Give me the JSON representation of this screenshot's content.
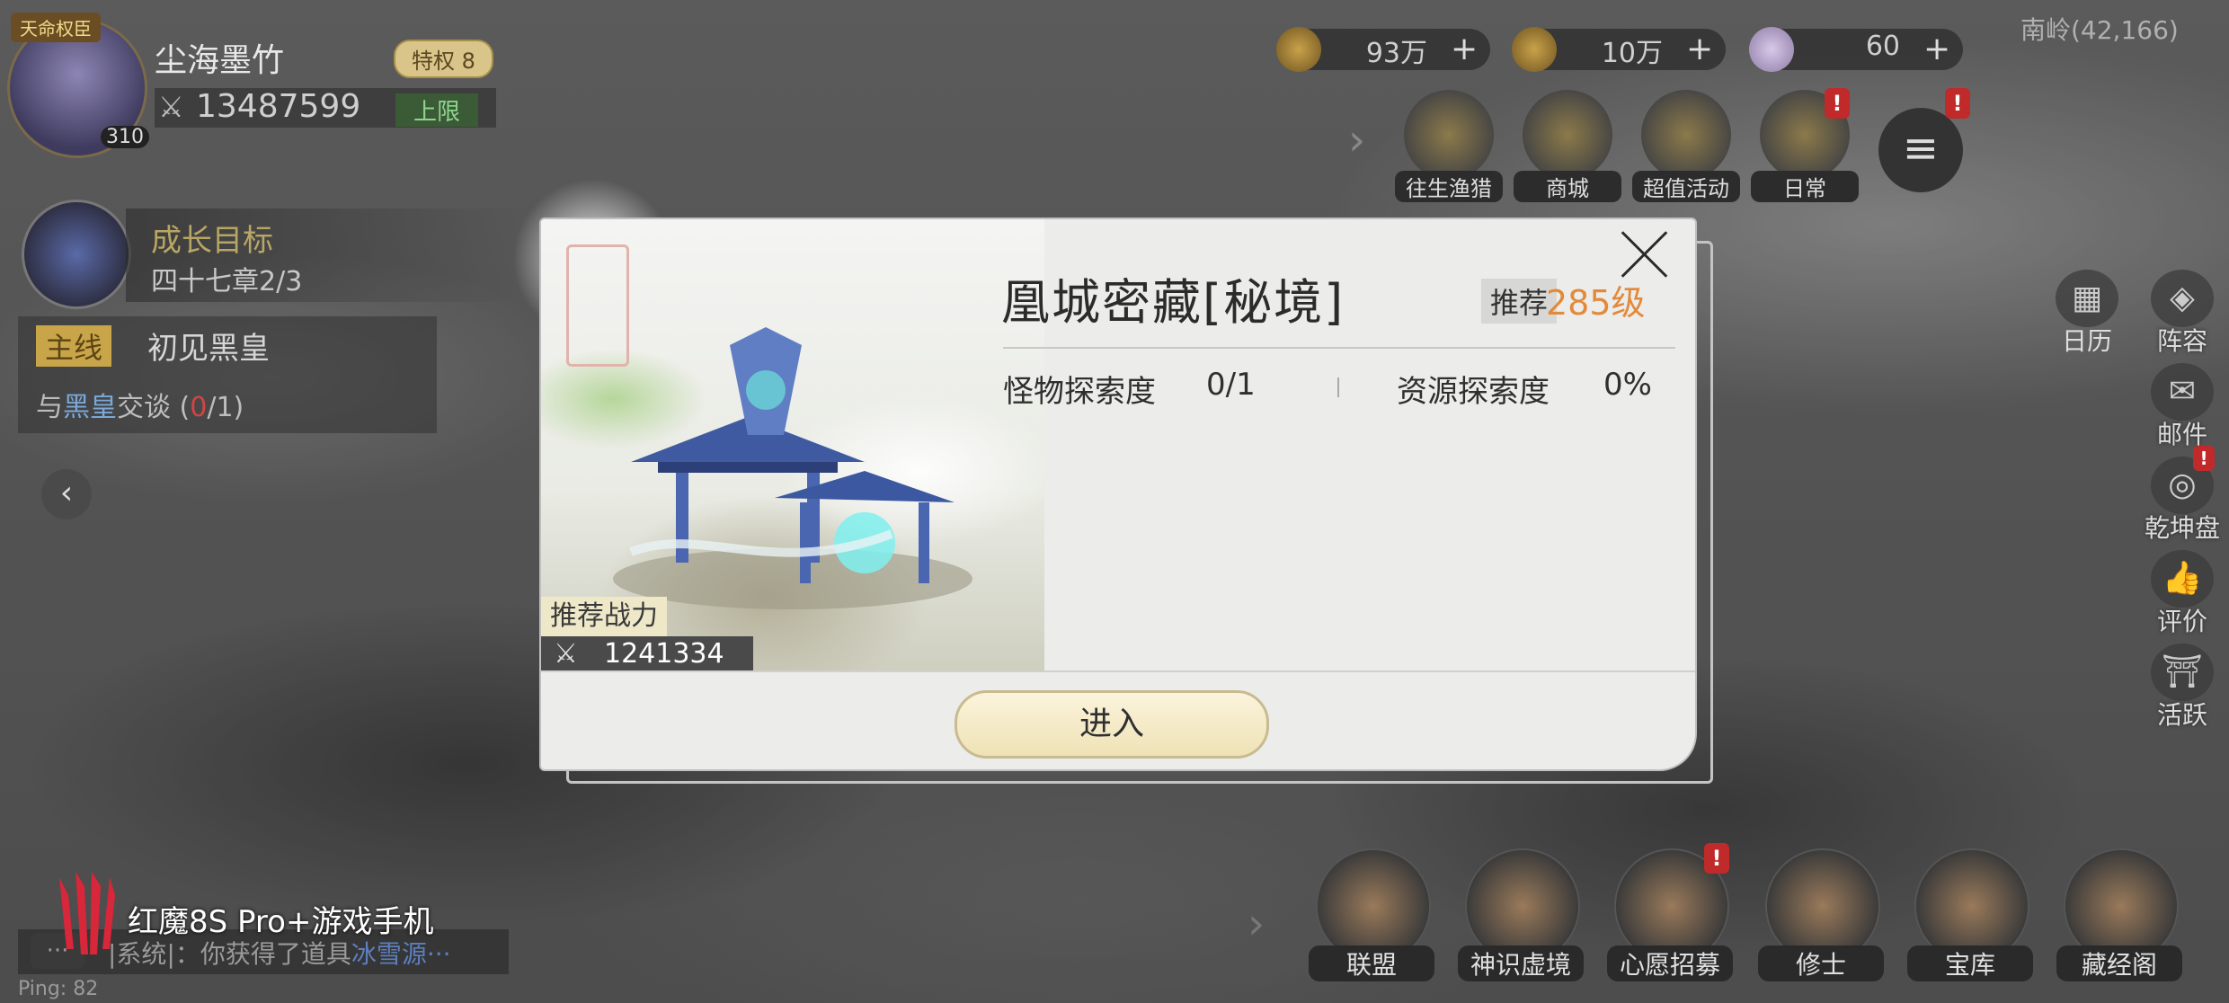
{
  "player": {
    "title_badge": "天命权臣",
    "name": "尘海墨竹",
    "vip": "特权 8",
    "power": "13487599",
    "limit": "上限",
    "level": "310"
  },
  "goal": {
    "title": "成长目标",
    "subtitle": "四十七章2/3"
  },
  "quest": {
    "tag": "主线",
    "name": "初见黑皇",
    "task_prefix": "与",
    "task_npc": "黑皇",
    "task_suffix": "交谈",
    "task_count_open": "(",
    "task_count_done": "0",
    "task_count_rest": "/1)"
  },
  "resources": [
    {
      "icon": "copper-coin-icon",
      "value": "93万"
    },
    {
      "icon": "gourd-icon",
      "value": "10万"
    },
    {
      "icon": "crystal-icon",
      "value": "60"
    }
  ],
  "location": "南岭(42,166)",
  "top_buttons": [
    {
      "label": "往生渔猎",
      "alert": false
    },
    {
      "label": "商城",
      "alert": false
    },
    {
      "label": "超值活动",
      "alert": false
    },
    {
      "label": "日常",
      "alert": true
    }
  ],
  "alert_mark": "!",
  "side_buttons": [
    {
      "label": "阵容",
      "icon": "formation-icon"
    },
    {
      "label": "邮件",
      "icon": "mail-icon"
    },
    {
      "label": "乾坤盘",
      "icon": "compass-icon"
    },
    {
      "label": "评价",
      "icon": "thumbs-up-icon"
    },
    {
      "label": "活跃",
      "icon": "pagoda-icon"
    }
  ],
  "calendar_label": "日历",
  "bottom_buttons": [
    {
      "label": "联盟",
      "alert": false
    },
    {
      "label": "神识虚境",
      "alert": false
    },
    {
      "label": "心愿招募",
      "alert": true
    },
    {
      "label": "修士",
      "alert": false
    },
    {
      "label": "宝库",
      "alert": false
    },
    {
      "label": "藏经阁",
      "alert": false
    }
  ],
  "chat": {
    "prefix": "|系统|：你获得了道具",
    "item": "冰雪源···"
  },
  "ping": "Ping: 82",
  "watermark": "红魔8S Pro+游戏手机",
  "dialog": {
    "title": "凰城密藏[秘境]",
    "recommend_tag": "推荐",
    "recommend_level": "285级",
    "monster_label": "怪物探索度",
    "monster_value": "0/1",
    "resource_label": "资源探索度",
    "resource_value": "0%",
    "rec_power_label": "推荐战力",
    "rec_power_value": "1241334",
    "enter_label": "进入"
  },
  "colors": {
    "accent_orange": "#e38a3a",
    "alert_red": "#c02a2a",
    "button_cream": "#f6ecca"
  }
}
